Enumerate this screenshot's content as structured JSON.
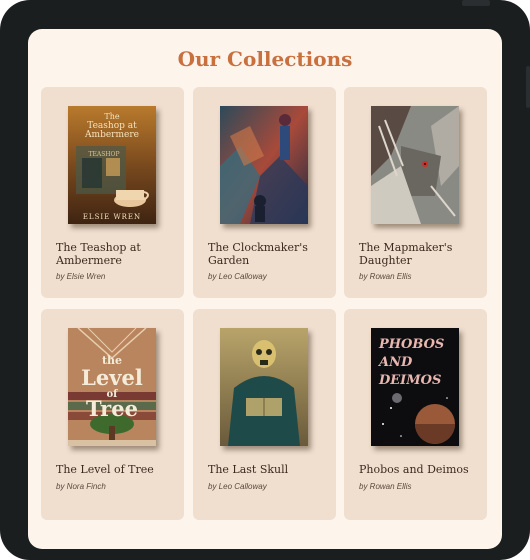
{
  "page": {
    "title": "Our Collections"
  },
  "books": [
    {
      "title": "The Teashop at Ambermere",
      "author": "by Elsie Wren",
      "cover_text": [
        "The",
        "Teashop at",
        "Ambermere"
      ],
      "cover_sign": "TEASHOP",
      "cover_author": "ELSIE WREN"
    },
    {
      "title": "The Clockmaker's Garden",
      "author": "by Leo Calloway"
    },
    {
      "title": "The Mapmaker's Daughter",
      "author": "by Rowan Ellis"
    },
    {
      "title": "The Level of Tree",
      "author": "by Nora Finch",
      "cover_text": [
        "the",
        "Level",
        "of",
        "Tree"
      ]
    },
    {
      "title": "The Last Skull",
      "author": "by Leo Calloway"
    },
    {
      "title": "Phobos and Deimos",
      "author": "by Rowan Ellis",
      "cover_text": [
        "PHOBOS",
        "AND",
        "DEIMOS"
      ]
    }
  ]
}
